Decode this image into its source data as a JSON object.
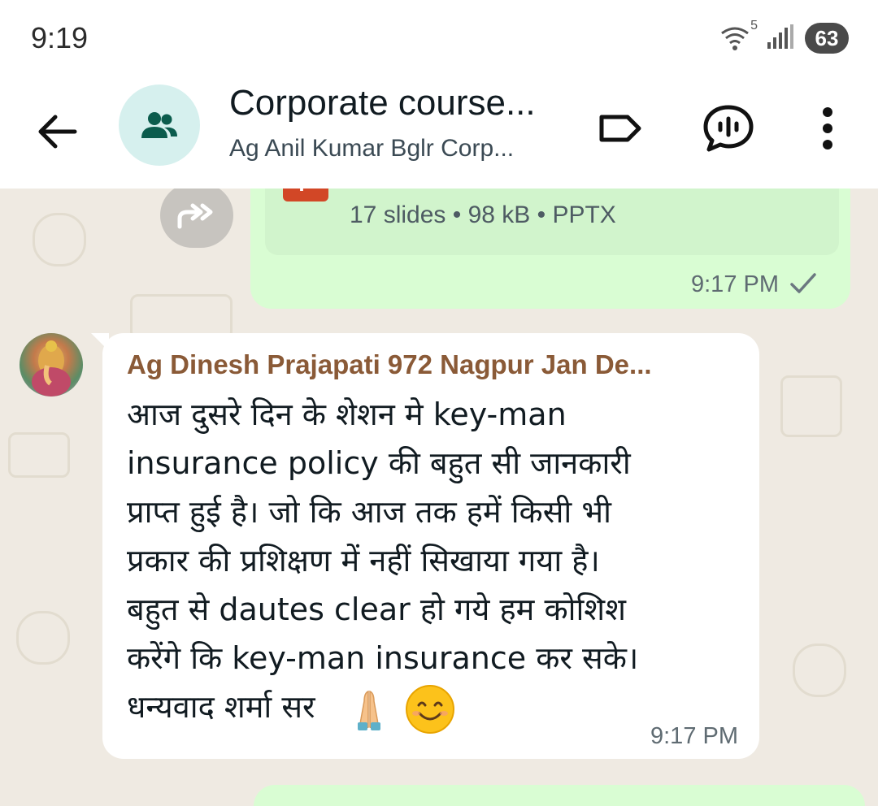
{
  "status_bar": {
    "time": "9:19",
    "wifi_label": "5",
    "battery": "63"
  },
  "header": {
    "title": "Corporate course...",
    "subtitle": "Ag Anil Kumar Bglr Corp...",
    "icons": [
      "back-arrow-icon",
      "group-icon",
      "label-icon",
      "voice-chat-icon",
      "more-vert-icon"
    ]
  },
  "messages": {
    "outgoing": {
      "file_badge": "P",
      "file_meta": "17 slides • 98 kB • PPTX",
      "time": "9:17 PM",
      "status_icon": "check-icon"
    },
    "incoming": {
      "sender": "Ag Dinesh Prajapati 972 Nagpur Jan De...",
      "lines": [
        "आज दुसरे दिन के शेशन मे key-man",
        "insurance policy की बहुत सी जानकारी",
        "प्राप्त हुई है।  जो कि आज तक हमें किसी भी",
        "प्रकार की प्रशिक्षण में नहीं सिखाया गया है।",
        "बहुत से dautes clear हो गये हम कोशिश",
        "करेंगे कि key-man insurance कर सके।",
        "धन्यवाद  शर्मा सर"
      ],
      "emojis": [
        "folded-hands-emoji",
        "smiling-face-emoji"
      ],
      "time": "9:17 PM"
    }
  },
  "colors": {
    "outgoing_bubble": "#d9fdd3",
    "incoming_bubble": "#ffffff",
    "chat_background": "#efeae2",
    "sender_name": "#8a5a37",
    "pptx_badge": "#d24726"
  }
}
